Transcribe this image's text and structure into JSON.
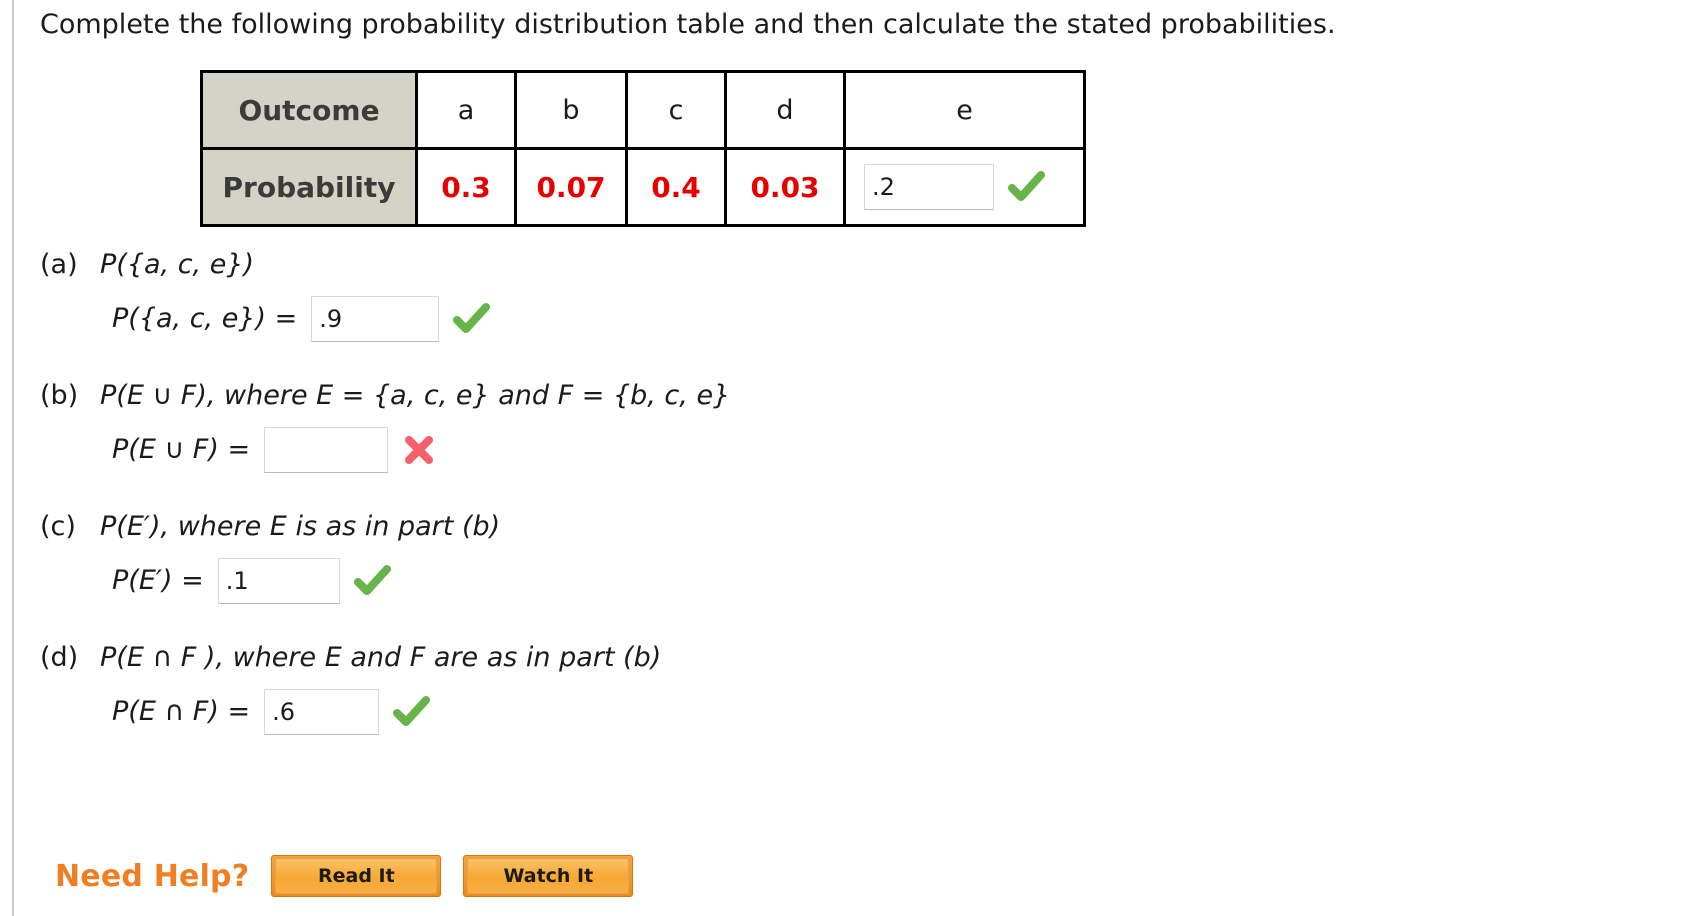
{
  "prompt": "Complete the following probability distribution table and then calculate the stated probabilities.",
  "table": {
    "row_headers": [
      "Outcome",
      "Probability"
    ],
    "outcomes": [
      "a",
      "b",
      "c",
      "d",
      "e"
    ],
    "probabilities": [
      "0.3",
      "0.07",
      "0.4",
      "0.03"
    ],
    "e_input": {
      "value": ".2",
      "placeholder": "",
      "status": "correct",
      "status_icon": "green-check-icon"
    }
  },
  "parts": [
    {
      "id": "a",
      "label": "(a)",
      "question": "P({a, c, e})",
      "answer_label": "P({a, c, e}) =",
      "input": {
        "value": ".9",
        "placeholder": ""
      },
      "status": "correct",
      "status_icon": "green-check-icon"
    },
    {
      "id": "b",
      "label": "(b)",
      "question": "P(E ∪ F), where E = {a, c, e} and F = {b, c, e}",
      "answer_label": "P(E ∪ F) =",
      "input": {
        "value": "",
        "placeholder": ""
      },
      "status": "incorrect",
      "status_icon": "red-x-icon"
    },
    {
      "id": "c",
      "label": "(c)",
      "question": "P(E′), where E is as in part (b)",
      "answer_label": "P(E′) =",
      "input": {
        "value": ".1",
        "placeholder": ""
      },
      "status": "correct",
      "status_icon": "green-check-icon"
    },
    {
      "id": "d",
      "label": "(d)",
      "question": "P(E ∩ F ), where E and F are as in part (b)",
      "answer_label": "P(E ∩ F) =",
      "input": {
        "value": ".6",
        "placeholder": ""
      },
      "status": "correct",
      "status_icon": "green-check-icon"
    }
  ],
  "need_help": {
    "label": "Need Help?",
    "buttons": [
      {
        "label": "Read It",
        "name": "read-it-button"
      },
      {
        "label": "Watch It",
        "name": "watch-it-button"
      }
    ]
  },
  "colors": {
    "probability_value": "#e60000",
    "header_cell_bg": "#d5d2c6",
    "correct_check": "#67b44a",
    "incorrect_x": "#f4616b",
    "need_help_orange": "#ef7f22"
  }
}
